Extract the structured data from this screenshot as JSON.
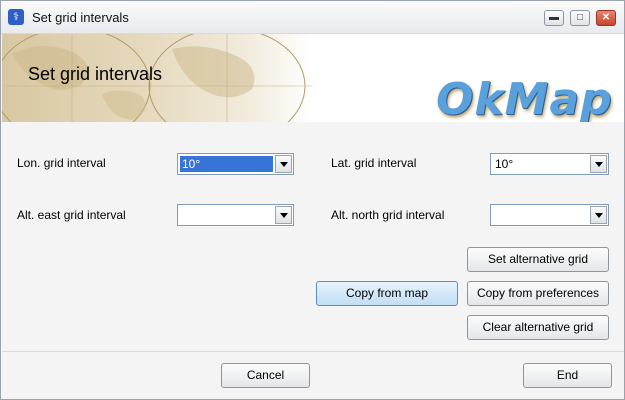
{
  "window": {
    "title": "Set grid intervals",
    "icon": "okmap-app-icon",
    "controls": [
      "minimize-icon",
      "maximize-icon",
      "close-icon"
    ]
  },
  "banner": {
    "title": "Set grid intervals",
    "logo_text": "OkMap"
  },
  "fields": {
    "lon_label": "Lon. grid interval",
    "lon_value": "10°",
    "lat_label": "Lat. grid interval",
    "lat_value": "10°",
    "alt_east_label": "Alt. east grid interval",
    "alt_east_value": "",
    "alt_north_label": "Alt. north grid interval",
    "alt_north_value": ""
  },
  "buttons": {
    "set_alternative": "Set alternative grid",
    "copy_from_map": "Copy from map",
    "copy_from_preferences": "Copy from preferences",
    "clear_alternative": "Clear alternative grid",
    "cancel": "Cancel",
    "end": "End"
  }
}
